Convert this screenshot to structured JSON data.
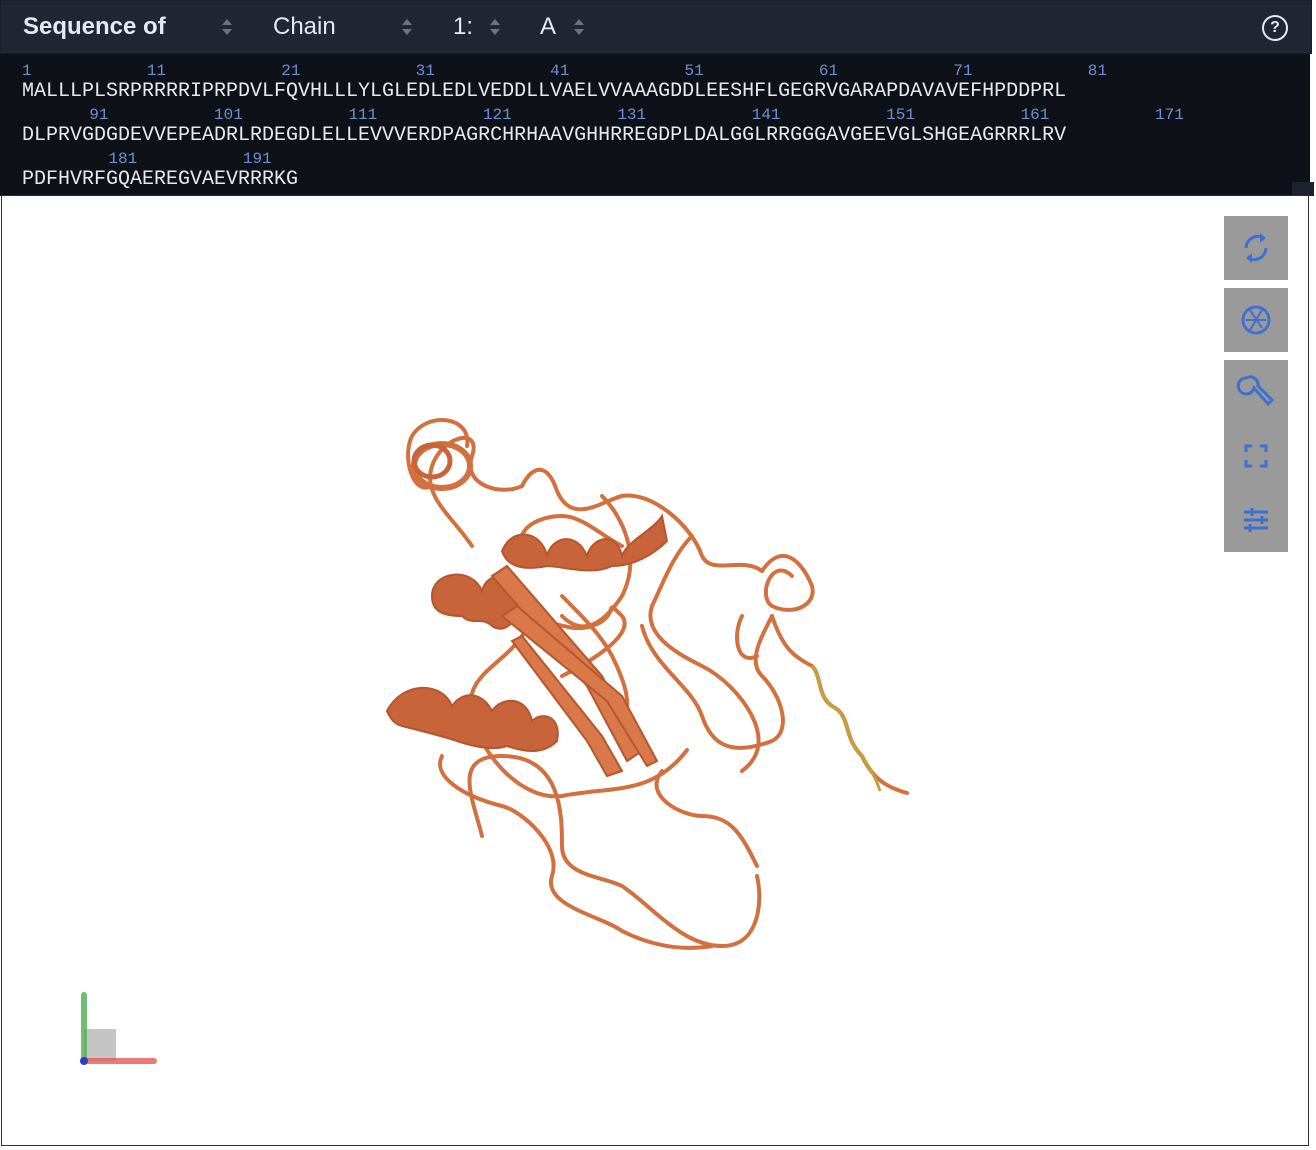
{
  "header": {
    "sequence_of_label": "Sequence of",
    "chain_label": "Chain",
    "entity_label": "1:",
    "chain_id": "A",
    "help_icon": "question-circle-icon"
  },
  "sequence": {
    "rows": [
      {
        "numbers": "1            11            21            31            41            51            61            71            81",
        "residues": "MALLLPLSRPRRRRIPRPDVLFQVHLLLYLGLEDLEDLVEDDLLVAELVVAAAGDDLEESHFLGEGRVGARAPDAVAVEFHPDDPRL"
      },
      {
        "numbers": "       91           101           111           121           131           141           151           161           171",
        "residues": "DLPRVGDGDEVVEPEADRLRDEGDLELLEVVVERDPAGRCHRHAAVGHHRREGDPLDALGGLRRGGGAVGEEVGLSHGEAGRRRLRV"
      },
      {
        "numbers": "         181           191",
        "residues": "PDFHVRFGQAEREGVAEVRRRKG"
      }
    ]
  },
  "viewer": {
    "controls": [
      {
        "icon": "reset-rotate-icon"
      },
      {
        "icon": "camera-shutter-icon"
      },
      {
        "icon": "wrench-icon"
      },
      {
        "icon": "fullscreen-icon"
      },
      {
        "icon": "sliders-icon"
      }
    ],
    "structure_color": "#d2713f",
    "axis_colors": {
      "x": "#e85a5a",
      "y": "#4caf50",
      "z": "#2d3acb"
    }
  }
}
